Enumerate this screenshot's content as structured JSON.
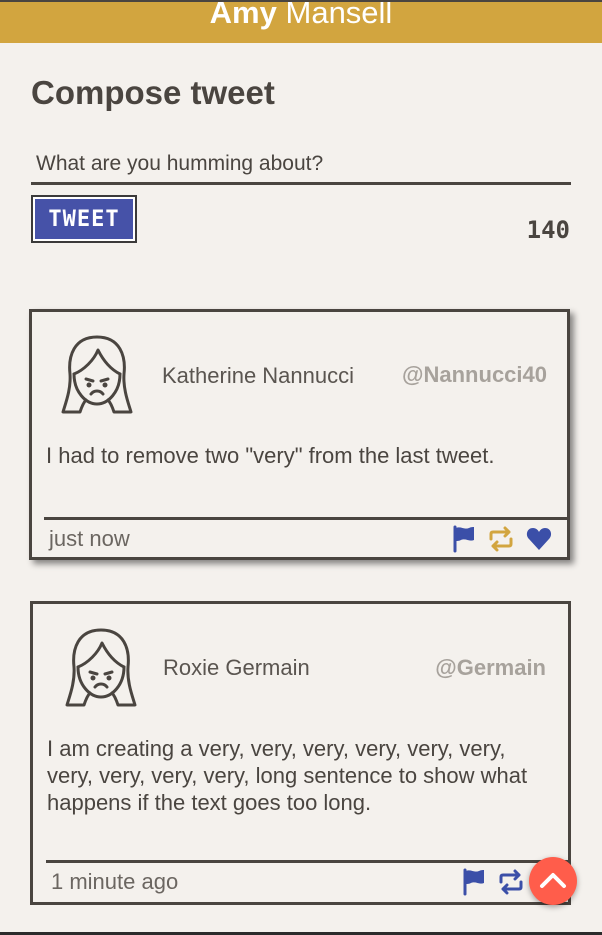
{
  "header": {
    "first_name": "Amy",
    "last_name": "Mansell"
  },
  "compose": {
    "title": "Compose tweet",
    "placeholder": "What are you humming about?",
    "button_label": "TWEET",
    "char_count": "140"
  },
  "tweets": [
    {
      "name": "Katherine Nannucci",
      "handle": "@Nannucci40",
      "text": "I had to remove two \"very\" from the last tweet.",
      "time": "just now"
    },
    {
      "name": "Roxie Germain",
      "handle": "@Germain",
      "text": "I am creating a very, very, very, very, very, very, very, very, very, very, long sentence to show what happens if the text goes too long.",
      "time": "1 minute ago"
    }
  ],
  "colors": {
    "accent_gold": "#d2a53f",
    "accent_blue": "#4652a8",
    "scroll_button": "#ff5d4b"
  },
  "icons": [
    "flag-icon",
    "retweet-icon",
    "heart-icon",
    "chevron-up-icon"
  ]
}
